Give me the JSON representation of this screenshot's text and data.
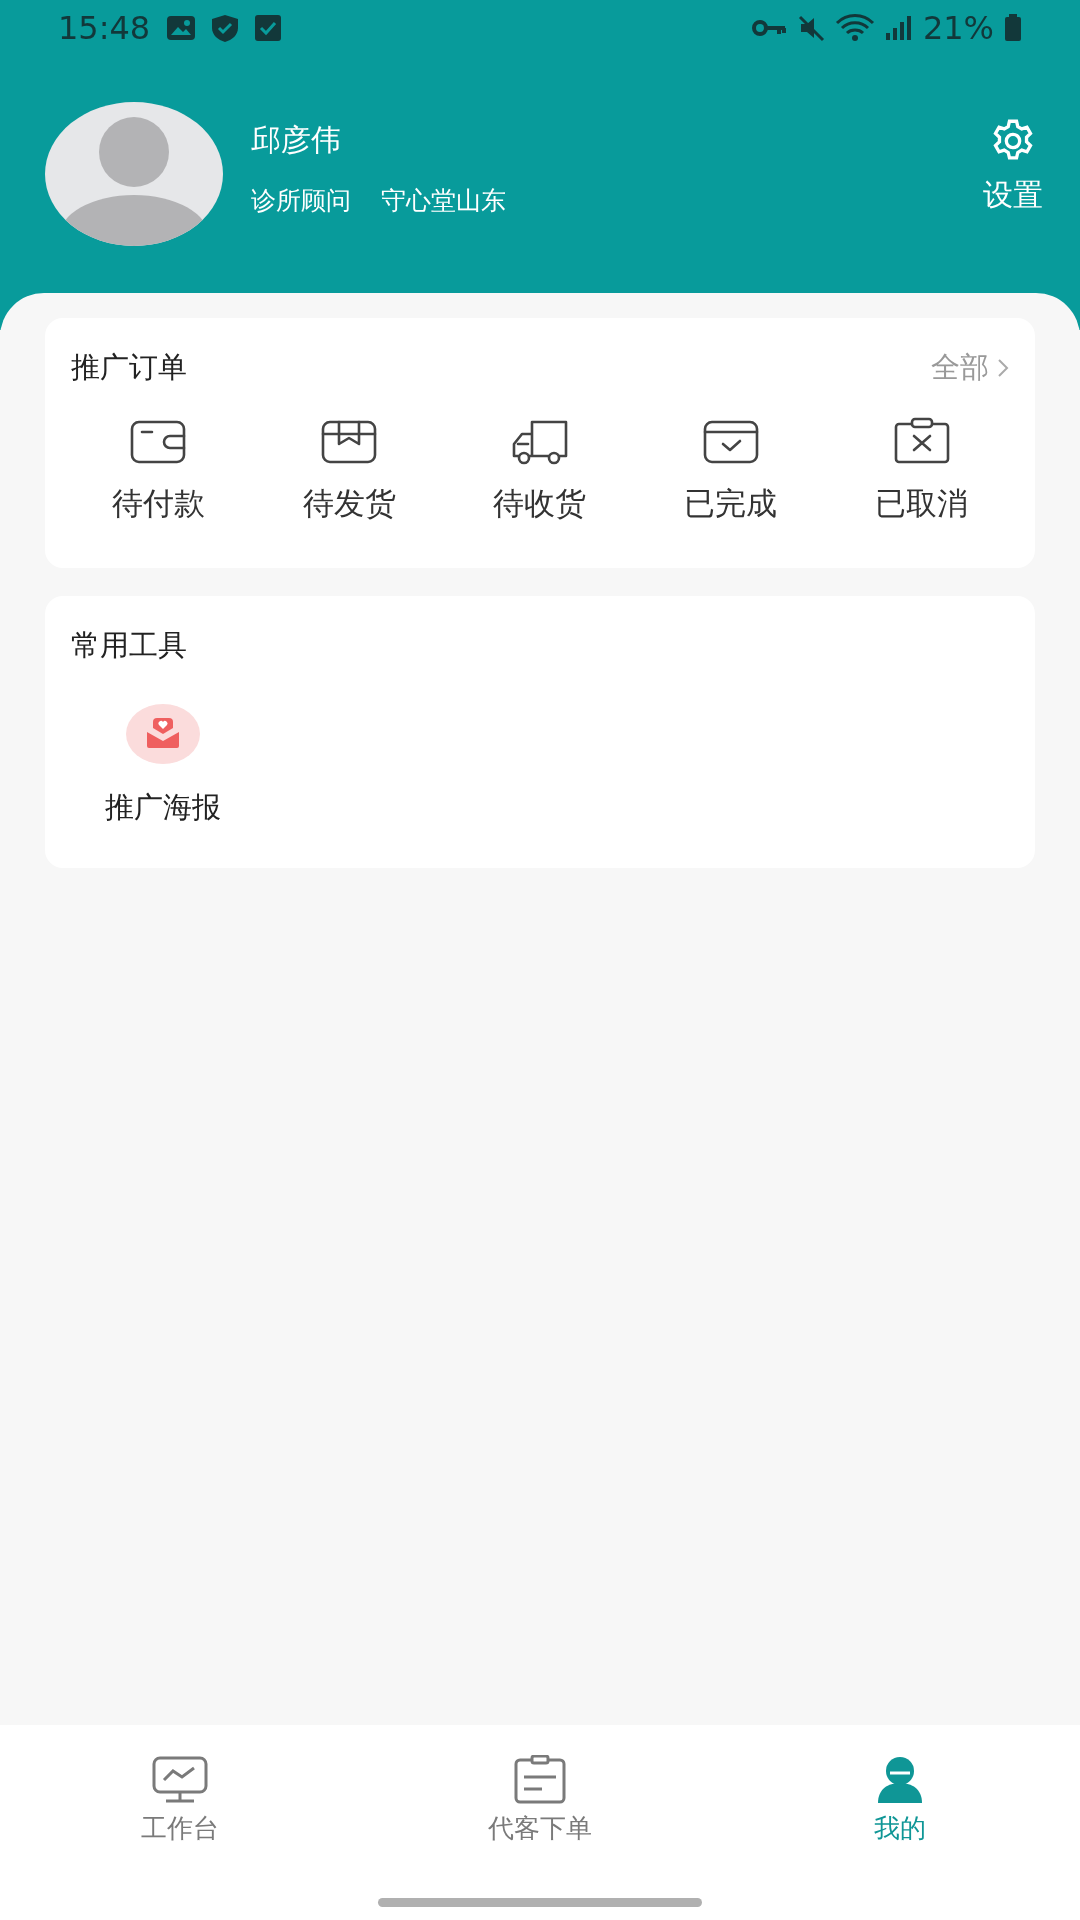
{
  "status_bar": {
    "time": "15:48",
    "battery": "21%"
  },
  "profile": {
    "name": "邱彦伟",
    "role": "诊所顾问",
    "organization": "守心堂山东"
  },
  "settings": {
    "label": "设置"
  },
  "orders": {
    "title": "推广订单",
    "more": "全部",
    "items": [
      {
        "label": "待付款",
        "kind": "wallet"
      },
      {
        "label": "待发货",
        "kind": "box"
      },
      {
        "label": "待收货",
        "kind": "truck"
      },
      {
        "label": "已完成",
        "kind": "done"
      },
      {
        "label": "已取消",
        "kind": "cancel"
      }
    ]
  },
  "tools": {
    "title": "常用工具",
    "items": [
      {
        "label": "推广海报",
        "kind": "poster"
      }
    ]
  },
  "tab_bar": [
    {
      "label": "工作台",
      "kind": "monitor",
      "selected": false
    },
    {
      "label": "代客下单",
      "kind": "clipboard",
      "selected": false
    },
    {
      "label": "我的",
      "kind": "person",
      "selected": true
    }
  ]
}
